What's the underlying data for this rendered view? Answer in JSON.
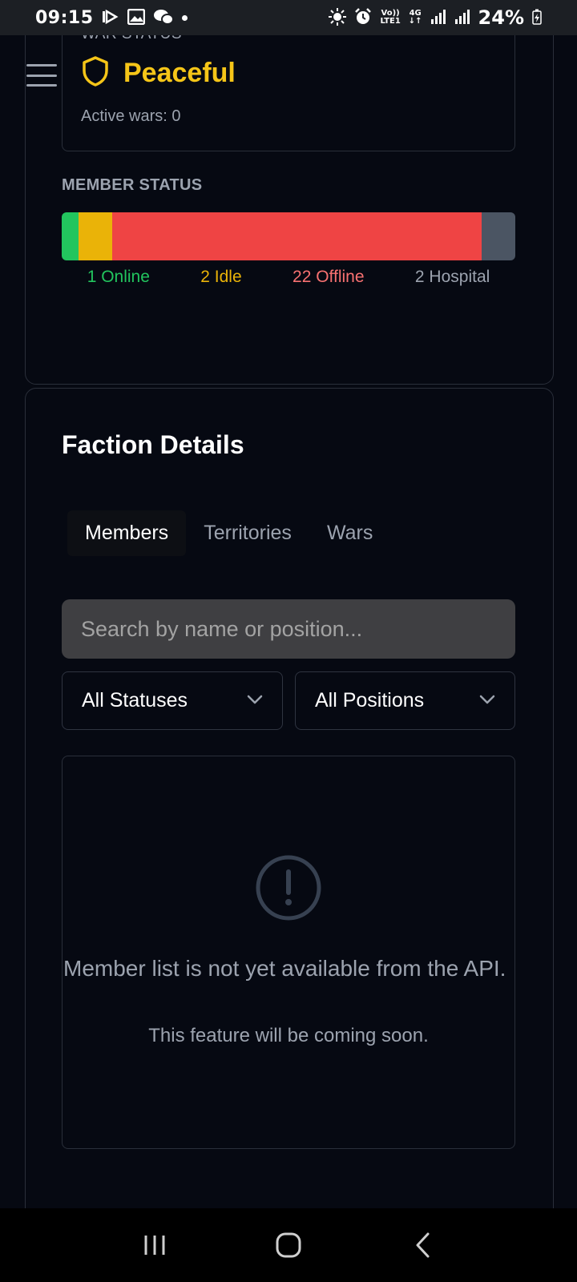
{
  "status_bar": {
    "time": "09:15",
    "battery": "24%",
    "network_top": "Vo))",
    "network_bottom": "LTE1",
    "gen": "4G"
  },
  "war_status": {
    "label": "WAR STATUS",
    "value": "Peaceful",
    "active_wars": "Active wars: 0"
  },
  "member_status": {
    "label": "MEMBER STATUS",
    "segments": [
      {
        "name": "online",
        "count": 1,
        "color": "#22c55e"
      },
      {
        "name": "idle",
        "count": 2,
        "color": "#eab308"
      },
      {
        "name": "offline",
        "count": 22,
        "color": "#ef4444"
      },
      {
        "name": "hospital",
        "count": 2,
        "color": "#4b5563"
      }
    ],
    "legend": {
      "online": "1 Online",
      "idle": "2 Idle",
      "offline": "22 Offline",
      "hospital": "2 Hospital"
    }
  },
  "faction_details": {
    "title": "Faction Details",
    "tabs": [
      {
        "label": "Members"
      },
      {
        "label": "Territories"
      },
      {
        "label": "Wars"
      }
    ],
    "search_placeholder": "Search by name or position...",
    "status_filter": "All Statuses",
    "position_filter": "All Positions",
    "empty_message": "Member list is not yet available from the API.",
    "empty_sub": "This feature will be coming soon."
  },
  "colors": {
    "accent": "#f5c518",
    "background": "#060912"
  }
}
